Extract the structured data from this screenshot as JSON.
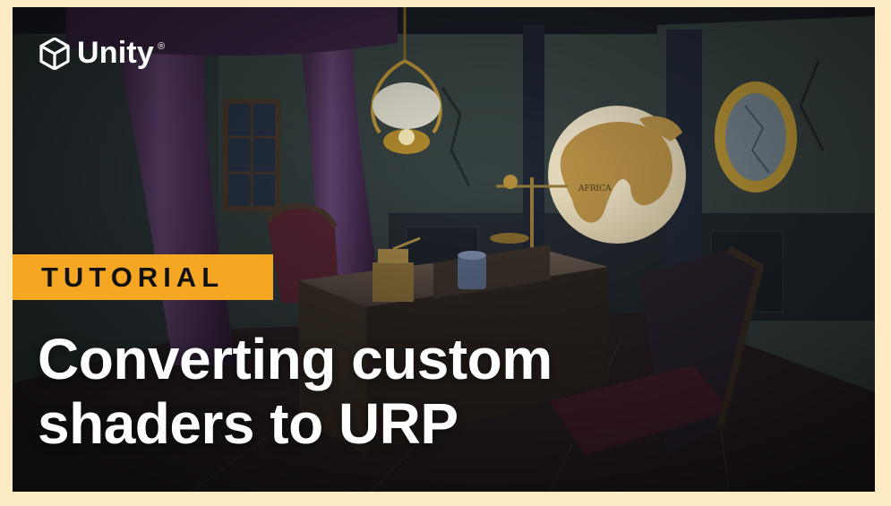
{
  "brand": {
    "name": "Unity",
    "registered": "®",
    "logo_icon": "unity-cube-logo"
  },
  "badge": {
    "label": "TUTORIAL",
    "color": "#f5a623"
  },
  "headline": {
    "line1": "Converting custom",
    "line2": "shaders to URP"
  },
  "colors": {
    "page_background": "#fdebc4",
    "scene_tone": "#2a3140"
  },
  "scene": {
    "objects": [
      "curtains",
      "hanging-lamp",
      "globe",
      "gold-mirror",
      "desk",
      "coffee-grinder",
      "mug",
      "scales",
      "chair"
    ],
    "globe_labels": [
      "AFRICA"
    ]
  }
}
